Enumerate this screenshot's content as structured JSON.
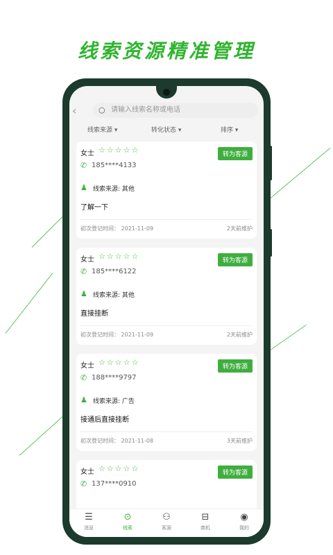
{
  "headline": "线索资源精准管理",
  "search": {
    "placeholder": "请输入线索名称或电话",
    "search_icon": "search-icon",
    "back_icon": "back-icon"
  },
  "filters": [
    {
      "label": "线索来源 ▾"
    },
    {
      "label": "转化状态 ▾"
    },
    {
      "label": "排序 ▾"
    }
  ],
  "cards": [
    {
      "name": "女士",
      "stars": "☆☆☆☆☆",
      "rating": 0,
      "phone": "185****4133",
      "button": "转为客源",
      "source": "线索来源: 其他",
      "note": "了解一下",
      "date": "初次登记时间： 2021-11-09",
      "maintained": "2天前维护"
    },
    {
      "name": "女士",
      "stars": "☆☆☆☆☆",
      "rating": 0,
      "phone": "185****6122",
      "button": "转为客源",
      "source": "线索来源: 其他",
      "note": "直接挂断",
      "date": "初次登记时间： 2021-11-09",
      "maintained": "2天前维护"
    },
    {
      "name": "女士",
      "stars": "☆☆☆☆☆",
      "rating": 0,
      "phone": "188****9797",
      "button": "转为客源",
      "source": "线索来源: 广告",
      "note": "接通后直接挂断",
      "date": "初次登记时间： 2021-11-08",
      "maintained": "3天前维护"
    },
    {
      "name": "女士",
      "stars": "☆☆☆☆☆",
      "rating": 0,
      "phone": "137****0910",
      "button": "转为客源",
      "source": "",
      "note": "",
      "date": "",
      "maintained": ""
    }
  ],
  "tabs": [
    {
      "label": "消息",
      "icon": "message-icon",
      "glyph": "☰"
    },
    {
      "label": "线索",
      "icon": "clue-icon",
      "glyph": "⊙"
    },
    {
      "label": "客源",
      "icon": "customers-icon",
      "glyph": "⚇"
    },
    {
      "label": "商机",
      "icon": "business-icon",
      "glyph": "⊟"
    },
    {
      "label": "我的",
      "icon": "profile-icon",
      "glyph": "◉"
    }
  ],
  "active_tab": "线索",
  "colors": {
    "accent": "#3fae3f",
    "headline": "#2fb52f",
    "phone_frame": "#1c3a2e"
  }
}
